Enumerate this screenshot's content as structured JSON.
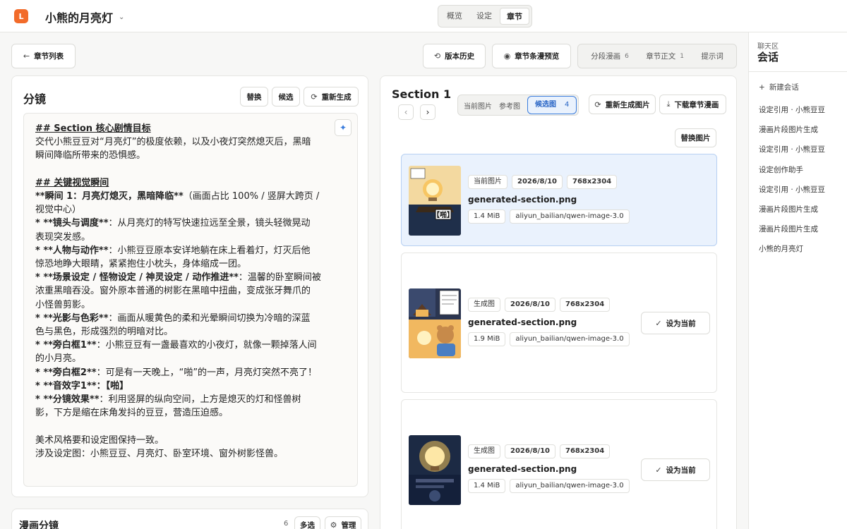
{
  "app": {
    "logo_letter": "L",
    "project_name": "小熊的月亮灯",
    "view_tabs": [
      "概览",
      "设定",
      "章节"
    ],
    "active_view_tab": 2
  },
  "toolbar": {
    "back_label": "章节列表",
    "history_label": "版本历史",
    "preview_label": "章节条漫预览",
    "tabs": [
      {
        "label": "分段漫画",
        "count": "6"
      },
      {
        "label": "章节正文",
        "count": "1"
      },
      {
        "label": "提示词",
        "count": ""
      }
    ]
  },
  "storyboard": {
    "title": "分镜",
    "buttons": [
      "替换",
      "候选",
      "重新生成"
    ],
    "lines": [
      {
        "text": "## Section 核心剧情目标",
        "style": "h"
      },
      {
        "text": "交代小熊豆豆对“月亮灯”的极度依赖，以及小夜灯突然熄灭后，黑暗",
        "style": ""
      },
      {
        "text": "瞬间降临所带来的恐惧感。",
        "style": ""
      },
      {
        "text": "",
        "style": ""
      },
      {
        "text": "## 关键视觉瞬间",
        "style": "h"
      },
      {
        "text": "**瞬间 1：月亮灯熄灭，黑暗降临**（画面占比 100% / 竖屏大跨页 /",
        "style": "mix1"
      },
      {
        "text": "视觉中心）",
        "style": ""
      },
      {
        "text": "* **镜头与调度**：从月亮灯的特写快速拉远至全景，镜头轻微晃动",
        "style": "mix2"
      },
      {
        "text": "表现突发感。",
        "style": ""
      },
      {
        "text": "* **人物与动作**：小熊豆豆原本安详地躺在床上看着灯，灯灭后他",
        "style": "mix2"
      },
      {
        "text": "惊恐地睁大眼睛，紧紧抱住小枕头，身体缩成一团。",
        "style": ""
      },
      {
        "text": "* **场景设定 / 怪物设定 / 神灵设定 / 动作推进**：温馨的卧室瞬间被",
        "style": "mix2"
      },
      {
        "text": "浓重黑暗吞没。窗外原本普通的树影在黑暗中扭曲，变成张牙舞爪的",
        "style": ""
      },
      {
        "text": "小怪兽剪影。",
        "style": ""
      },
      {
        "text": "* **光影与色彩**：画面从暖黄色的柔和光晕瞬间切换为冷暗的深蓝",
        "style": "mix2"
      },
      {
        "text": "色与黑色，形成强烈的明暗对比。",
        "style": ""
      },
      {
        "text": "* **旁白框1**：小熊豆豆有一盏最喜欢的小夜灯，就像一颗掉落人间",
        "style": "mix2"
      },
      {
        "text": "的小月亮。",
        "style": ""
      },
      {
        "text": "* **旁白框2**：可是有一天晚上，“啪”的一声，月亮灯突然不亮了！",
        "style": "mix2"
      },
      {
        "text": "* **音效字1**：【啪】",
        "style": "mix3"
      },
      {
        "text": "* **分镜效果**：利用竖屏的纵向空间，上方是熄灭的灯和怪兽树",
        "style": "mix2"
      },
      {
        "text": "影，下方是缩在床角发抖的豆豆，营造压迫感。",
        "style": ""
      },
      {
        "text": "",
        "style": ""
      },
      {
        "text": "美术风格要和设定图保持一致。",
        "style": ""
      },
      {
        "text": "涉及设定图：小熊豆豆、月亮灯、卧室环境、窗外树影怪兽。",
        "style": ""
      }
    ]
  },
  "comic": {
    "title": "漫画分镜",
    "count": "6",
    "multi_label": "多选",
    "manage_label": "管理"
  },
  "section": {
    "title": "Section 1",
    "img_tabs": [
      {
        "label": "当前图片",
        "count": ""
      },
      {
        "label": "参考图",
        "count": ""
      },
      {
        "label": "候选图",
        "count": "4"
      }
    ],
    "active_img_tab": 2,
    "regen_label": "重新生成图片",
    "download_label": "下载章节漫画",
    "replace_label": "替换图片",
    "set_current_label": "设为当前",
    "cards": [
      {
        "tag": "当前图片",
        "date": "2026/8/10",
        "dims": "768x2304",
        "filename": "generated-section.png",
        "size": "1.4 MiB",
        "model": "aliyun_bailian/qwen-image-3.0",
        "selected": true,
        "sfx": "【啪】"
      },
      {
        "tag": "生成图",
        "date": "2026/8/10",
        "dims": "768x2304",
        "filename": "generated-section.png",
        "size": "1.9 MiB",
        "model": "aliyun_bailian/qwen-image-3.0",
        "selected": false,
        "sfx": ""
      },
      {
        "tag": "生成图",
        "date": "2026/8/10",
        "dims": "768x2304",
        "filename": "generated-section.png",
        "size": "1.4 MiB",
        "model": "aliyun_bailian/qwen-image-3.0",
        "selected": false,
        "sfx": ""
      }
    ]
  },
  "chat": {
    "subtitle": "聊天区",
    "title": "会话",
    "new_label": "新建会话",
    "items": [
      "设定引用 · 小熊豆豆",
      "漫画片段图片生成",
      "设定引用 · 小熊豆豆",
      "设定创作助手",
      "设定引用 · 小熊豆豆",
      "漫画片段图片生成",
      "漫画片段图片生成",
      "小熊的月亮灯"
    ]
  }
}
